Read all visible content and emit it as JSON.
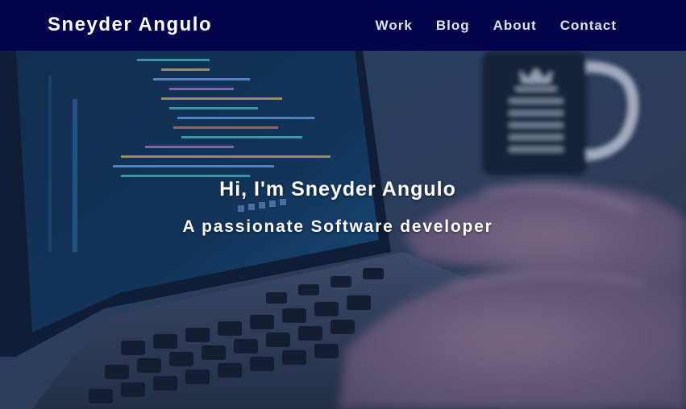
{
  "navbar": {
    "brand": "Sneyder Angulo",
    "links": [
      "Work",
      "Blog",
      "About",
      "Contact"
    ]
  },
  "hero": {
    "title": "Hi, I'm Sneyder Angulo",
    "subtitle": "A passionate Software developer",
    "background_image": "laptop-coding-photo"
  },
  "colors": {
    "navbar_bg": "#02034a",
    "nav_text": "#dfe3ef",
    "hero_text": "#ffffff"
  }
}
